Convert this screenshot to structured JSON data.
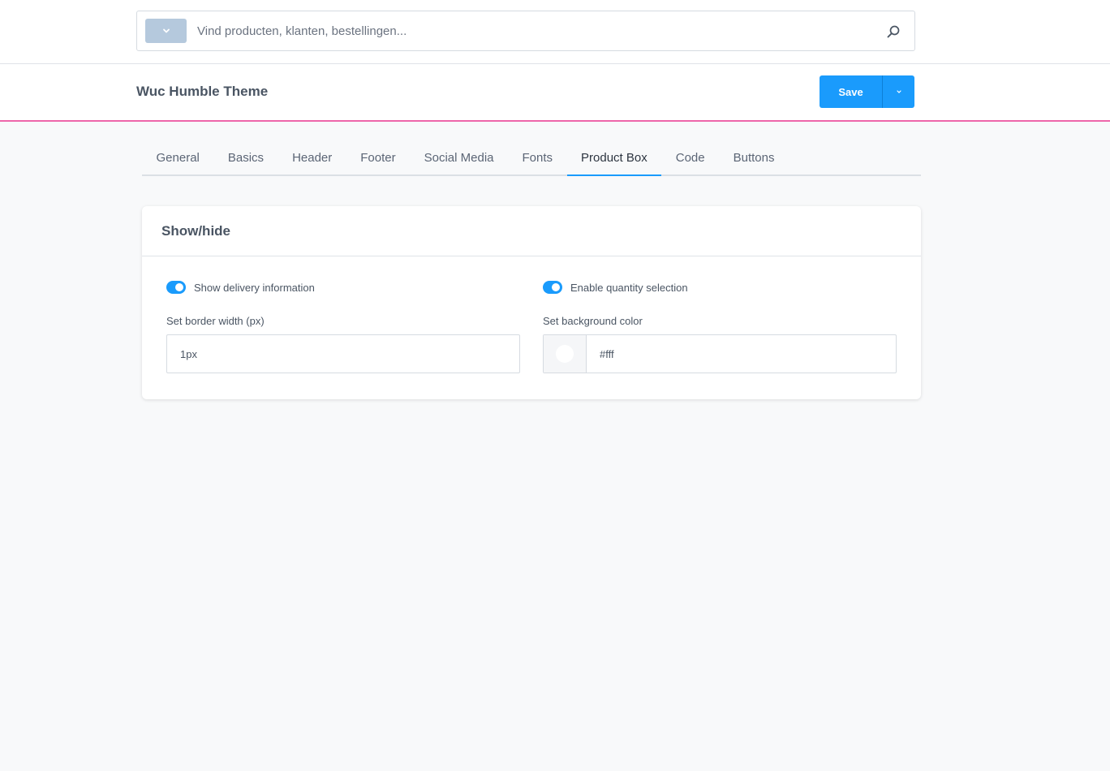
{
  "search": {
    "placeholder": "Vind producten, klanten, bestellingen...",
    "value": "",
    "scope_icon": "chevron-down-icon",
    "submit_icon": "search-icon"
  },
  "header": {
    "title": "Wuc Humble Theme",
    "save_label": "Save",
    "save_menu_icon": "chevron-down-icon",
    "accent_line_color": "#ee66aa"
  },
  "tabs": [
    {
      "label": "General",
      "active": false
    },
    {
      "label": "Basics",
      "active": false
    },
    {
      "label": "Header",
      "active": false
    },
    {
      "label": "Footer",
      "active": false
    },
    {
      "label": "Social Media",
      "active": false
    },
    {
      "label": "Fonts",
      "active": false
    },
    {
      "label": "Product Box",
      "active": true
    },
    {
      "label": "Code",
      "active": false
    },
    {
      "label": "Buttons",
      "active": false
    }
  ],
  "card": {
    "title": "Show/hide",
    "left": {
      "toggle_label": "Show delivery information",
      "toggle_on": true,
      "field_label": "Set border width (px)",
      "field_value": "1px"
    },
    "right": {
      "toggle_label": "Enable quantity selection",
      "toggle_on": true,
      "field_label": "Set background color",
      "field_value": "#fff",
      "swatch_color": "#ffffff"
    }
  },
  "colors": {
    "primary": "#1a9bfc",
    "scope_button": "#b5c9dd",
    "background": "#f8f9fa"
  }
}
